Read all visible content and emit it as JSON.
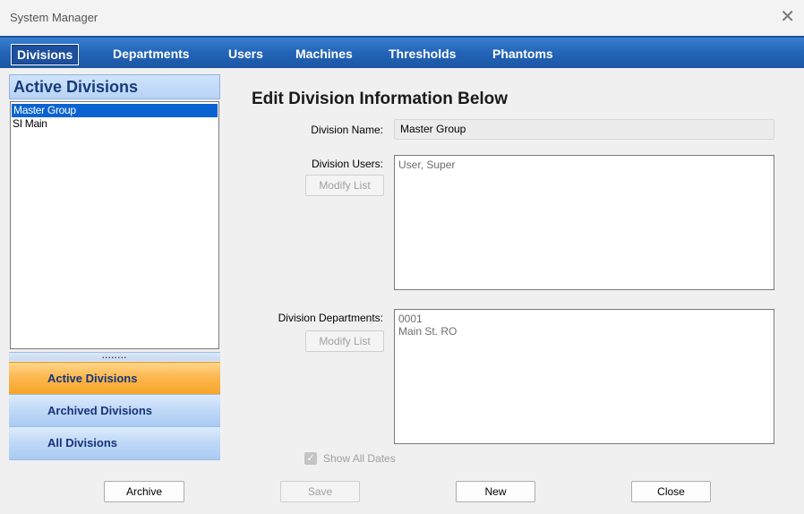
{
  "window": {
    "title": "System Manager",
    "close_glyph": "✕"
  },
  "tabs": [
    {
      "label": "Divisions"
    },
    {
      "label": "Departments"
    },
    {
      "label": "Users"
    },
    {
      "label": "Machines"
    },
    {
      "label": "Thresholds"
    },
    {
      "label": "Phantoms"
    }
  ],
  "left_panel": {
    "header": "Active Divisions",
    "items": [
      {
        "label": "Master Group"
      },
      {
        "label": "SI Main"
      }
    ],
    "splitter_dots": "........",
    "nav": [
      {
        "label": "Active Divisions"
      },
      {
        "label": "Archived Divisions"
      },
      {
        "label": "All Divisions"
      }
    ]
  },
  "form": {
    "heading": "Edit Division Information Below",
    "division_name_label": "Division Name:",
    "division_name_value": "Master Group",
    "division_users_label": "Division Users:",
    "division_users": [
      "User, Super"
    ],
    "modify_list_label": "Modify List",
    "division_departments_label": "Division Departments:",
    "division_departments": [
      "0001",
      "Main St. RO"
    ],
    "show_all_dates_label": "Show All Dates",
    "show_all_dates_checked": true
  },
  "buttons": {
    "archive": "Archive",
    "save": "Save",
    "new": "New",
    "close": "Close"
  },
  "colors": {
    "tab_bar": "#2264b8",
    "selected_item": "#0a63d1",
    "active_nav": "#fbb64c",
    "inactive_nav": "#c1d9f7"
  }
}
